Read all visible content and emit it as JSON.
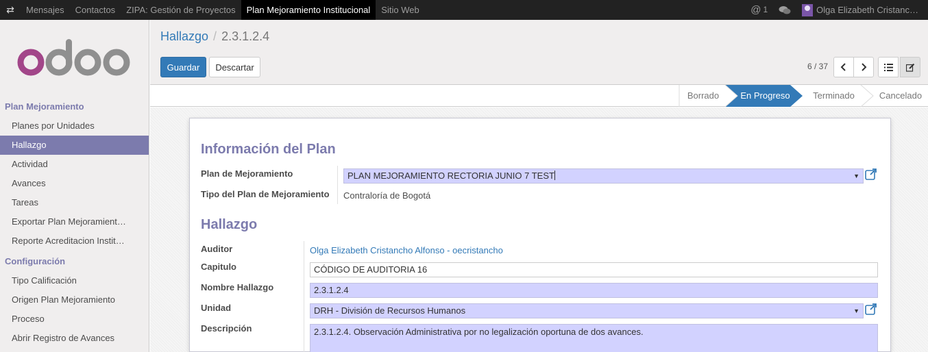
{
  "topbar": {
    "menu": [
      "Mensajes",
      "Contactos",
      "ZIPA: Gestión de Proyectos",
      "Plan Mejoramiento Institucional",
      "Sitio Web"
    ],
    "active_index": 3,
    "mentions_count": "1",
    "user_name": "Olga Elizabeth Cristanc…"
  },
  "sidebar": {
    "section1": "Plan Mejoramiento",
    "items1": [
      "Planes por Unidades",
      "Hallazgo",
      "Actividad",
      "Avances",
      "Tareas",
      "Exportar Plan Mejoramient…",
      "Reporte Acreditacion Instit…"
    ],
    "active_item": "Hallazgo",
    "section2": "Configuración",
    "items2": [
      "Tipo Calificación",
      "Origen Plan Mejoramiento",
      "Proceso",
      "Abrir Registro de Avances"
    ]
  },
  "control_panel": {
    "breadcrumb_parent": "Hallazgo",
    "breadcrumb_current": "2.3.1.2.4",
    "save_label": "Guardar",
    "discard_label": "Descartar",
    "pager": "6 / 37"
  },
  "statusbar": {
    "stages": [
      "Borrado",
      "En Progreso",
      "Terminado",
      "Cancelado"
    ],
    "active_stage": "En Progreso"
  },
  "form": {
    "section_plan": "Información del Plan",
    "plan_label": "Plan de Mejoramiento",
    "plan_value": "PLAN MEJORAMIENTO RECTORIA JUNIO 7 TEST",
    "tipo_label": "Tipo del Plan de Mejoramiento",
    "tipo_value": "Contraloría de Bogotá",
    "section_hallazgo": "Hallazgo",
    "auditor_label": "Auditor",
    "auditor_value": "Olga Elizabeth Cristancho Alfonso - oecristancho",
    "capitulo_label": "Capitulo",
    "capitulo_value": "CÓDIGO DE AUDITORIA 16",
    "nombre_label": "Nombre Hallazgo",
    "nombre_value": "2.3.1.2.4",
    "unidad_label": "Unidad",
    "unidad_value": "DRH - División de Recursos Humanos",
    "descripcion_label": "Descripción",
    "descripcion_value": "2.3.1.2.4. Observación  Administrativa por no legalización oportuna de dos avances."
  }
}
